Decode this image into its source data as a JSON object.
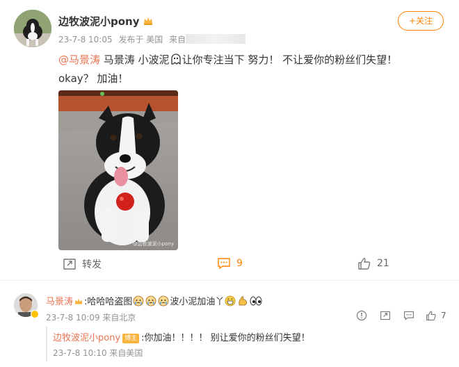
{
  "post": {
    "username": "边牧波泥小pony",
    "date": "23-7-8 10:05",
    "published_from": "发布于 美国",
    "source_prefix": "来自",
    "follow_label": "+关注",
    "text": {
      "mention": "@马景涛",
      "part1": " 马景涛 小波泥",
      "part2": "让你专注当下 努力！ 不让爱你的粉丝们失望！",
      "line2": "okay？  加油！"
    },
    "photo_watermark": "@边牧波泥小pony"
  },
  "actions": {
    "repost_label": "转发",
    "comment_count": "9",
    "like_count": "21"
  },
  "comment": {
    "username": "马景涛",
    "text_part1": ":哈哈哈盗图",
    "text_part2": "波小泥加油丫",
    "meta": "23-7-8 10:09 来自北京",
    "like_count": "7"
  },
  "reply": {
    "username": "边牧波泥小pony",
    "badge": "博主",
    "text": ":你加油！！！！ 别让爱你的粉丝们失望！",
    "meta": "23-7-8 10:10 来自美国"
  },
  "colors": {
    "accent": "#ff8200",
    "mention": "#eb7350",
    "meta": "#939393"
  }
}
